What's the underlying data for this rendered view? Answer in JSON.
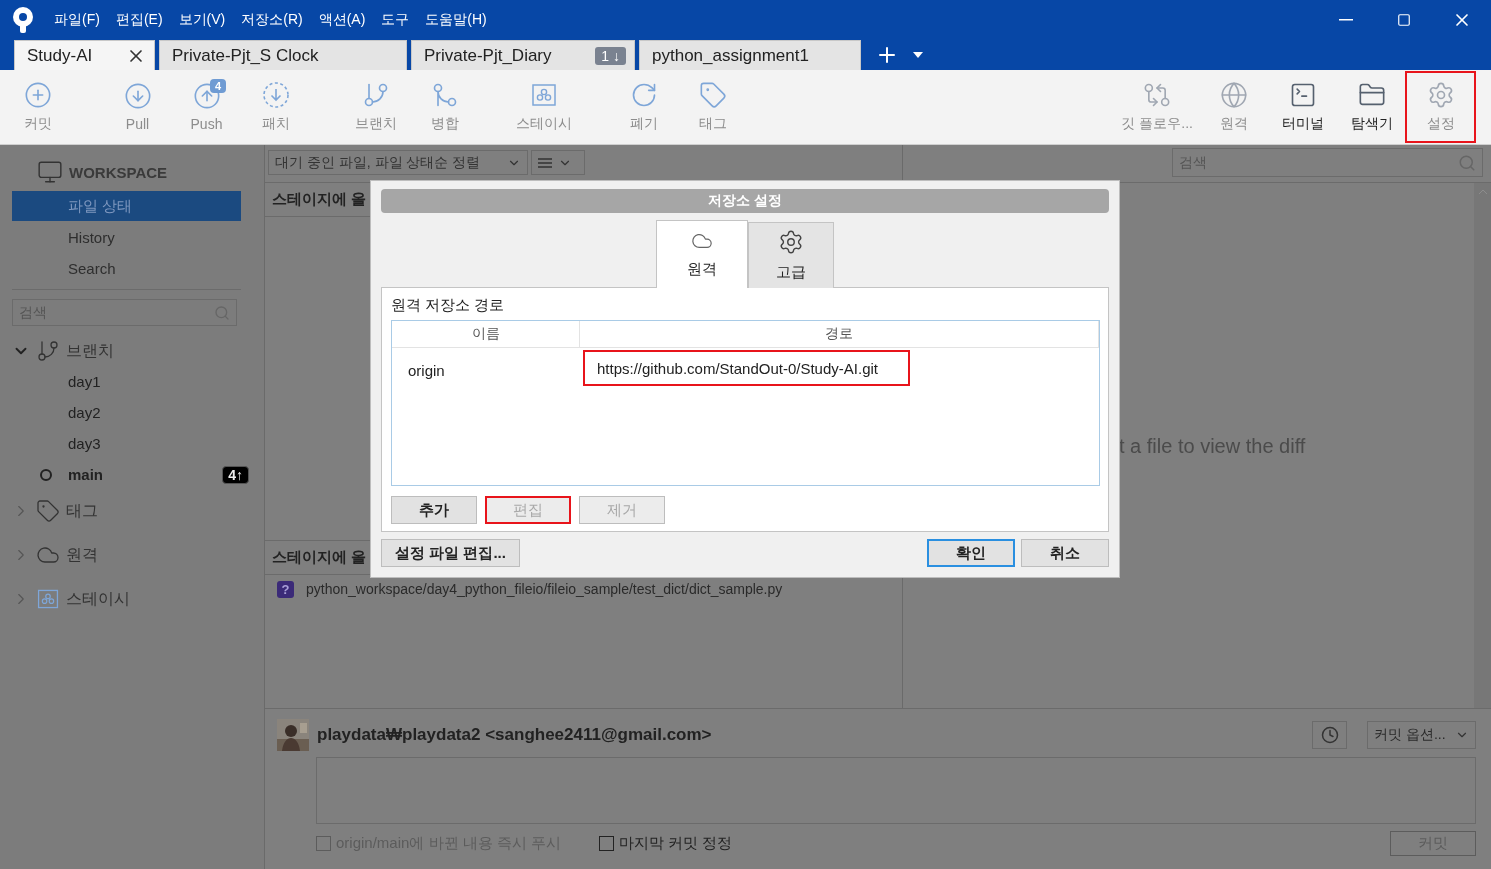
{
  "menu": [
    "파일(F)",
    "편집(E)",
    "보기(V)",
    "저장소(R)",
    "액션(A)",
    "도구",
    "도움말(H)"
  ],
  "tabs": [
    {
      "label": "Study-AI",
      "selected": true
    },
    {
      "label": "Private-Pjt_S Clock",
      "selected": false
    },
    {
      "label": "Private-Pjt_Diary",
      "selected": false,
      "badge": "1 ↓"
    },
    {
      "label": "python_assignment1",
      "selected": false
    }
  ],
  "toolbar": {
    "left": [
      {
        "kind": "commit",
        "label": "커밋",
        "disabled": true
      },
      {
        "kind": "pull",
        "label": "Pull",
        "disabled": true
      },
      {
        "kind": "push",
        "label": "Push",
        "disabled": true,
        "badge": "4"
      },
      {
        "kind": "patch",
        "label": "패치",
        "disabled": true
      },
      {
        "kind": "branch",
        "label": "브랜치",
        "disabled": true
      },
      {
        "kind": "merge",
        "label": "병합",
        "disabled": true
      },
      {
        "kind": "stash",
        "label": "스테이시",
        "disabled": true
      },
      {
        "kind": "discard",
        "label": "폐기",
        "disabled": true
      },
      {
        "kind": "tag",
        "label": "태그",
        "disabled": true
      }
    ],
    "right": [
      {
        "kind": "flow",
        "label": "깃 플로우...",
        "disabled": true,
        "highlighted": false
      },
      {
        "kind": "remote",
        "label": "원격",
        "disabled": true,
        "highlighted": false
      },
      {
        "kind": "terminal",
        "label": "터미널",
        "disabled": false,
        "highlighted": false
      },
      {
        "kind": "explorer",
        "label": "탐색기",
        "disabled": false,
        "highlighted": false
      },
      {
        "kind": "settings",
        "label": "설정",
        "disabled": true,
        "highlighted": true
      }
    ]
  },
  "sidebar": {
    "title": "WORKSPACE",
    "items": [
      {
        "label": "파일 상태",
        "selected": true
      },
      {
        "label": "History",
        "selected": false
      },
      {
        "label": "Search",
        "selected": false
      }
    ],
    "search": {
      "placeholder": "검색"
    },
    "tree": [
      {
        "kind": "branches",
        "label": "브랜치",
        "expanded": true,
        "children": [
          {
            "label": "day1",
            "current": false
          },
          {
            "label": "day2",
            "current": false
          },
          {
            "label": "day3",
            "current": false
          },
          {
            "label": "main",
            "current": true,
            "badge": "4↑"
          }
        ]
      },
      {
        "kind": "tags",
        "label": "태그",
        "expanded": false
      },
      {
        "kind": "remotes",
        "label": "원격",
        "expanded": false
      },
      {
        "kind": "stashes",
        "label": "스테이시",
        "expanded": false
      }
    ]
  },
  "files": {
    "sort": "대기 중인 파일, 파일 상태순 정렬",
    "section_1": "스테이지에 올",
    "section_2": "스테이지에 올",
    "items": [
      {
        "status": "?",
        "path": "python_workspace/day4_python_fileio/fileio_sample/test_dict/dict_sample.py"
      }
    ]
  },
  "diff": {
    "search": {
      "placeholder": "검색"
    },
    "message": "t a file to view the diff"
  },
  "commit": {
    "author": "playdata₩playdata2 <sanghee2411@gmail.com>",
    "options": "커밋 옵션...",
    "checkboxes": [
      {
        "label": "origin/main에 바뀐 내용 즉시 푸시",
        "checked": false,
        "disabled": true
      },
      {
        "label": "마지막 커밋 정정",
        "checked": false,
        "disabled": false
      }
    ],
    "button": {
      "label": "커밋",
      "disabled": true
    }
  },
  "dialog": {
    "title": "저장소 설정",
    "tabs": [
      {
        "kind": "remote",
        "label": "원격",
        "selected": true
      },
      {
        "kind": "advanced",
        "label": "고급",
        "selected": false
      }
    ],
    "section_title": "원격 저장소 경로",
    "columns": [
      "이름",
      "경로"
    ],
    "remotes": [
      {
        "name": "origin",
        "path": "https://github.com/StandOut-0/Study-AI.git",
        "highlighted": true
      }
    ],
    "buttons": [
      {
        "label": "추가",
        "disabled": false,
        "highlighted": false
      },
      {
        "label": "편집",
        "disabled": true,
        "highlighted": true
      },
      {
        "label": "제거",
        "disabled": true,
        "highlighted": false
      }
    ],
    "edit_config": "설정 파일 편집...",
    "footer": [
      {
        "label": "확인",
        "default": true
      },
      {
        "label": "취소",
        "default": false
      }
    ]
  }
}
